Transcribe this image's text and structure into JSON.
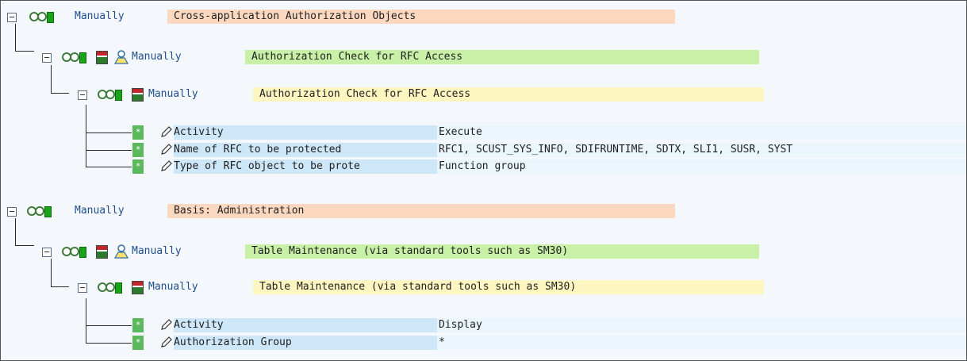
{
  "tree": {
    "nodes": [
      {
        "id": "n1",
        "level": 0,
        "status": "Manually",
        "text": "Cross-application Authorization Objects"
      },
      {
        "id": "n2",
        "level": 1,
        "status": "Manually",
        "text": "Authorization Check for RFC Access"
      },
      {
        "id": "n3",
        "level": 2,
        "status": "Manually",
        "text": "Authorization Check for RFC Access"
      },
      {
        "id": "n4",
        "level": 0,
        "status": "Manually",
        "text": "Basis: Administration"
      },
      {
        "id": "n5",
        "level": 1,
        "status": "Manually",
        "text": "Table Maintenance (via standard tools such as SM30)"
      },
      {
        "id": "n6",
        "level": 2,
        "status": "Manually",
        "text": "Table Maintenance (via standard tools such as SM30)"
      }
    ],
    "fields_rfc": [
      {
        "star": "*",
        "name": "Activity",
        "value": "Execute"
      },
      {
        "star": "*",
        "name": "Name of RFC to be protected",
        "value": "RFC1, SCUST_SYS_INFO, SDIFRUNTIME, SDTX, SLI1, SUSR, SYST"
      },
      {
        "star": "*",
        "name": "Type of RFC object to be prote",
        "value": "Function group"
      }
    ],
    "fields_table": [
      {
        "star": "*",
        "name": "Activity",
        "value": "Display"
      },
      {
        "star": "*",
        "name": "Authorization Group",
        "value": "*"
      }
    ]
  },
  "colors": {
    "level0_bg": "#fcd8c0",
    "level1_bg": "#c8f0a6",
    "level2_bg": "#fdf6c0",
    "field_name_bg": "#cde6f8",
    "field_value_bg": "#eaf6fc",
    "link_text": "#1f4e8c"
  }
}
